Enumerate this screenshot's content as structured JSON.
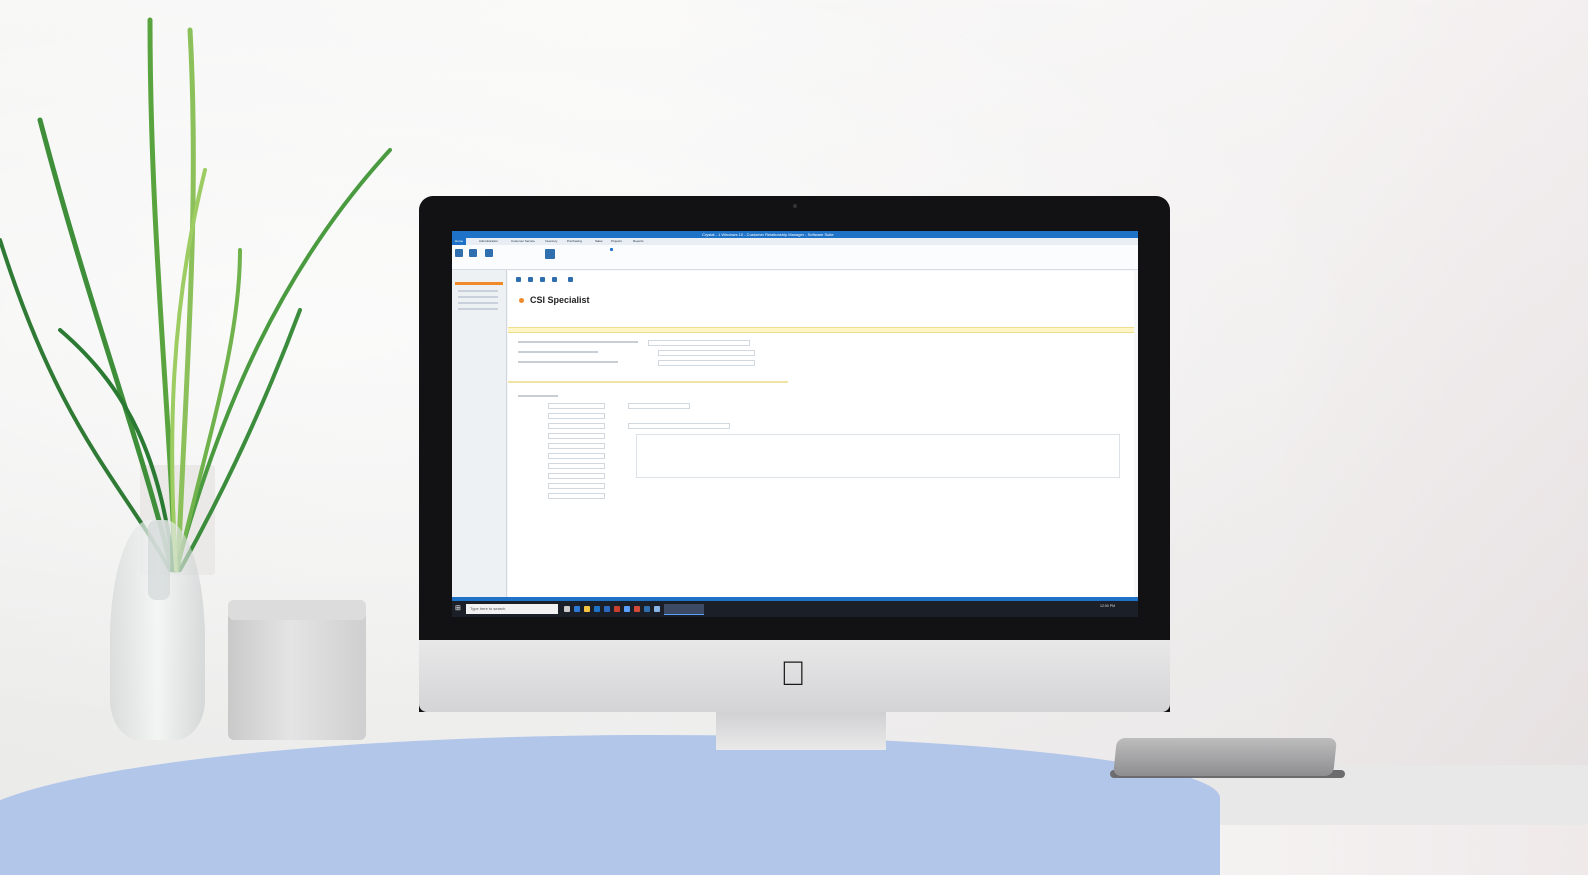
{
  "screen": {
    "window_title": "Crystal - 1 Windows 10 - Customer Relationship Manager - Software Suite",
    "ribbon_tabs": [
      "Home",
      "Administration",
      "Customer Service",
      "Inventory",
      "Purchasing",
      "Sales",
      "Projects",
      "Reports"
    ],
    "page_title": "CSI Specialist",
    "search_placeholder": "Type here to search",
    "clock": "12:00 PM"
  },
  "colors": {
    "accent_blue": "#1e73c8",
    "accent_orange": "#f0892a",
    "desk_wave": "#b2c6ea"
  },
  "icons": [
    "apple-logo-icon",
    "windows-start-icon",
    "taskbar-app-icons"
  ]
}
